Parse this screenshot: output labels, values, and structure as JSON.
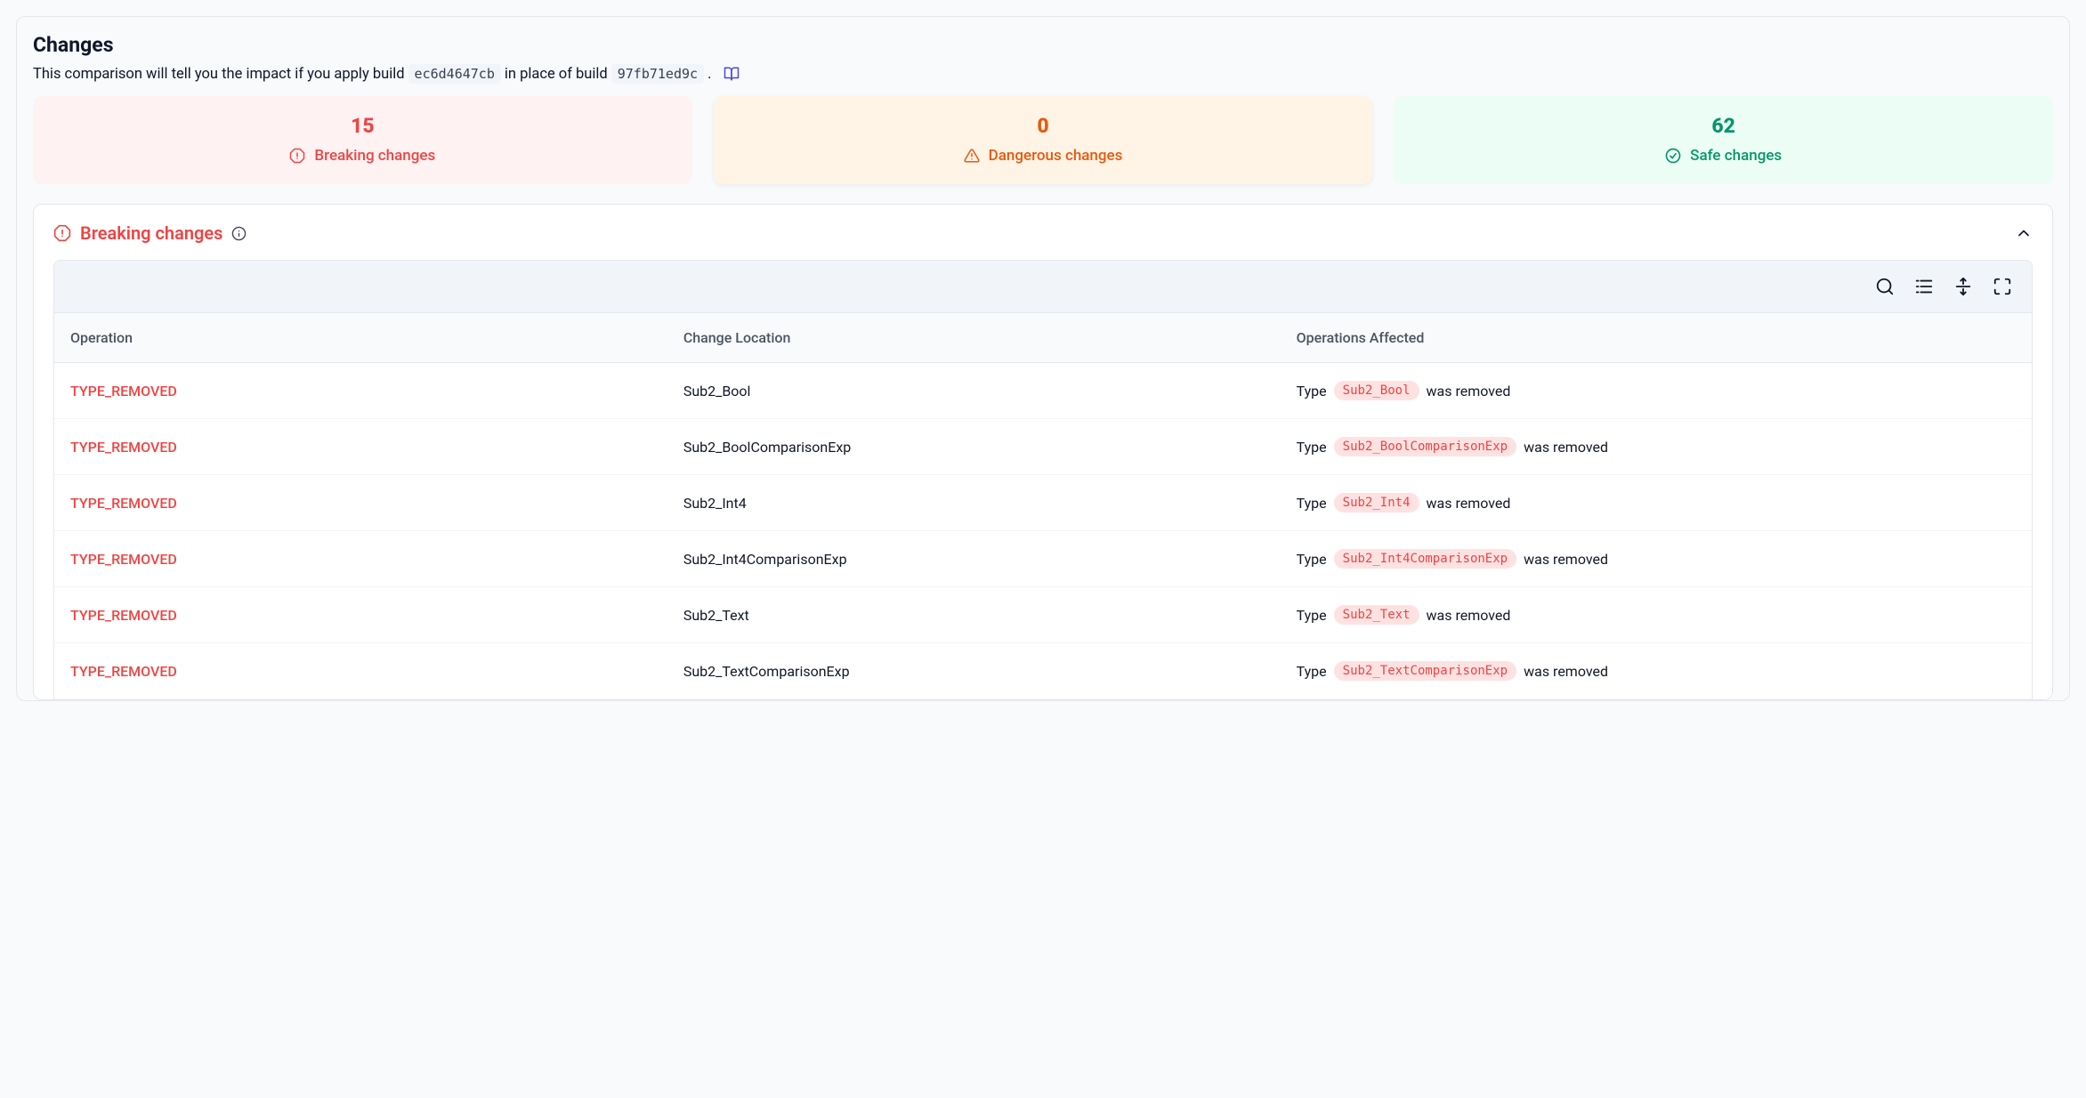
{
  "header": {
    "title": "Changes",
    "desc_prefix": "This comparison will tell you the impact if you apply build",
    "build_new": "ec6d4647cb",
    "desc_mid": "in place of build",
    "build_old": "97fb71ed9c",
    "desc_suffix": "."
  },
  "summary": {
    "breaking": {
      "count": "15",
      "label": "Breaking changes"
    },
    "dangerous": {
      "count": "0",
      "label": "Dangerous changes"
    },
    "safe": {
      "count": "62",
      "label": "Safe changes"
    }
  },
  "section": {
    "title": "Breaking changes"
  },
  "table": {
    "columns": [
      "Operation",
      "Change Location",
      "Operations Affected"
    ],
    "affected_prefix": "Type",
    "affected_suffix": "was removed",
    "rows": [
      {
        "operation": "TYPE_REMOVED",
        "location": "Sub2_Bool",
        "chip": "Sub2_Bool"
      },
      {
        "operation": "TYPE_REMOVED",
        "location": "Sub2_BoolComparisonExp",
        "chip": "Sub2_BoolComparisonExp"
      },
      {
        "operation": "TYPE_REMOVED",
        "location": "Sub2_Int4",
        "chip": "Sub2_Int4"
      },
      {
        "operation": "TYPE_REMOVED",
        "location": "Sub2_Int4ComparisonExp",
        "chip": "Sub2_Int4ComparisonExp"
      },
      {
        "operation": "TYPE_REMOVED",
        "location": "Sub2_Text",
        "chip": "Sub2_Text"
      },
      {
        "operation": "TYPE_REMOVED",
        "location": "Sub2_TextComparisonExp",
        "chip": "Sub2_TextComparisonExp"
      }
    ]
  }
}
